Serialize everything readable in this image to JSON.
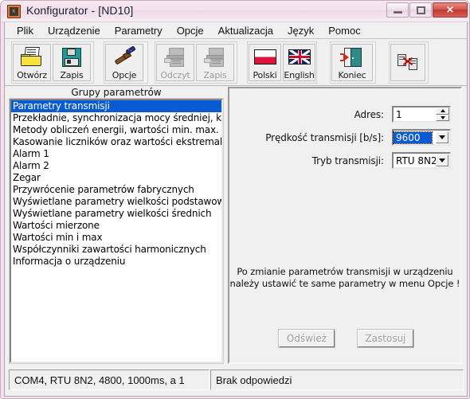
{
  "window": {
    "title": "Konfigurator - [ND10]",
    "app_icon": "configurator-app-icon",
    "minimize_label": "Minimalizuj",
    "maximize_label": "Maksymalizuj",
    "close_label": "×"
  },
  "menu": {
    "items": [
      {
        "label": "Plik",
        "mnemonic": "P"
      },
      {
        "label": "Urządzenie",
        "mnemonic": "U"
      },
      {
        "label": "Parametry",
        "mnemonic": "a"
      },
      {
        "label": "Opcje",
        "mnemonic": "O"
      },
      {
        "label": "Aktualizacja",
        "mnemonic": "k"
      },
      {
        "label": "Język",
        "mnemonic": "z"
      },
      {
        "label": "Pomoc",
        "mnemonic": "m"
      }
    ]
  },
  "toolbar": {
    "groups": [
      {
        "name": "file-group",
        "buttons": [
          {
            "label": "Otwórz",
            "icon": "open-folder-icon",
            "enabled": true
          },
          {
            "label": "Zapis",
            "icon": "floppy-disk-icon",
            "enabled": true
          }
        ]
      },
      {
        "name": "options-group",
        "buttons": [
          {
            "label": "Opcje",
            "icon": "brush-icon",
            "enabled": true
          }
        ]
      },
      {
        "name": "device-io-group",
        "buttons": [
          {
            "label": "Odczyt",
            "icon": "device-read-icon",
            "enabled": false
          },
          {
            "label": "Zapis",
            "icon": "device-write-icon",
            "enabled": false
          }
        ]
      },
      {
        "name": "language-group",
        "buttons": [
          {
            "label": "Polski",
            "icon": "poland-flag-icon",
            "enabled": true
          },
          {
            "label": "English",
            "icon": "uk-flag-icon",
            "enabled": true
          }
        ]
      },
      {
        "name": "exit-group",
        "buttons": [
          {
            "label": "Koniec",
            "icon": "exit-door-icon",
            "enabled": true
          }
        ]
      },
      {
        "name": "disconnect-group",
        "buttons": [
          {
            "label": "",
            "icon": "disconnect-icon",
            "enabled": true
          }
        ]
      }
    ]
  },
  "left_panel": {
    "header": "Grupy parametrów",
    "items": [
      "Parametry transmisji",
      "Przekładnie, synchronizacja mocy średniej, kod",
      "Metody obliczeń energii, wartości min. max.",
      "Kasowanie liczników oraz wartości ekstremalnych",
      "Alarm 1",
      "Alarm 2",
      "Zegar",
      "Przywrócenie parametrów fabrycznych",
      "Wyświetlane parametry wielkości podstawowych",
      "Wyświetlane parametry wielkości średnich",
      "Wartości mierzone",
      "Wartości min i max",
      "Współczynniki zawartości harmonicznych",
      "Informacja o urządzeniu"
    ],
    "selected_index": 0
  },
  "right_panel": {
    "fields": [
      {
        "label": "Adres:",
        "value": "1",
        "control": "spinner",
        "name": "address-spinner"
      },
      {
        "label": "Prędkość transmisji [b/s]:",
        "value": "9600",
        "control": "combobox",
        "focused": true,
        "name": "baudrate-combobox"
      },
      {
        "label": "Tryb transmisji:",
        "value": "RTU 8N2",
        "control": "combobox",
        "focused": false,
        "name": "transmission-mode-combobox"
      }
    ],
    "hint_line1": "Po zmianie parametrów transmisji w urządzeniu",
    "hint_line2": "należy ustawić te same parametry w menu Opcje !",
    "buttons": [
      {
        "label": "Odśwież",
        "enabled": false,
        "name": "refresh-button"
      },
      {
        "label": "Zastosuj",
        "enabled": false,
        "name": "apply-button"
      }
    ]
  },
  "statusbar": {
    "connection": "COM4, RTU 8N2, 4800, 1000ms, a 1",
    "status": "Brak odpowiedzi"
  },
  "colors": {
    "selection": "#0a5ad4",
    "title_bar": "#f3e2ec",
    "face": "#f0f0f0",
    "close_button": "#cd4a40"
  }
}
